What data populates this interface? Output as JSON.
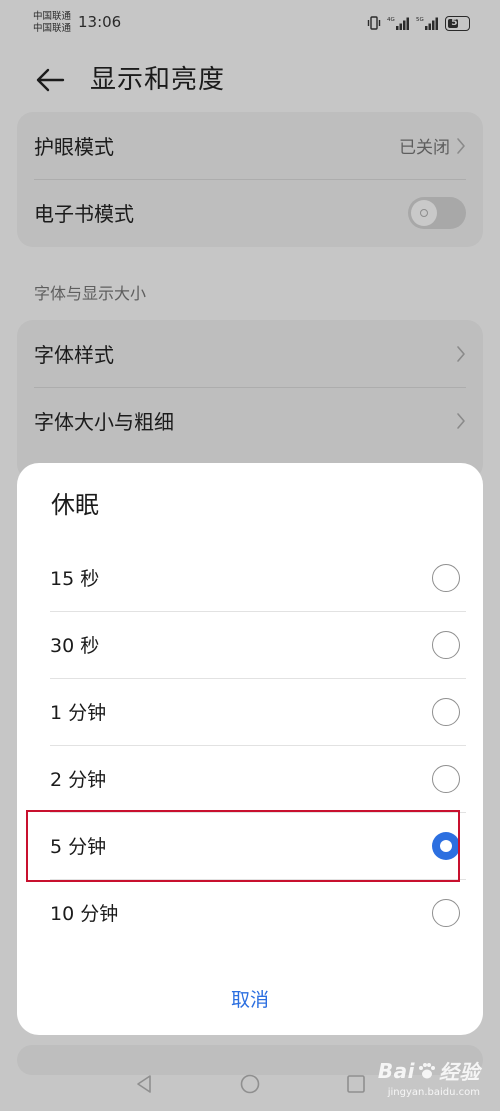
{
  "status_bar": {
    "carrier_1": "中国联通",
    "carrier_2": "中国联通",
    "time": "13:06",
    "battery": "58",
    "battery_level": 0.58,
    "network_1": "4G",
    "network_2": "5G",
    "icons": [
      "vibrate-icon",
      "signal-icon",
      "signal-icon"
    ]
  },
  "header": {
    "title": "显示和亮度",
    "back_icon": "arrow-left-icon"
  },
  "settings": {
    "eye_comfort": {
      "label": "护眼模式",
      "value": "已关闭"
    },
    "ebook_mode": {
      "label": "电子书模式",
      "enabled": false
    },
    "font_section_title": "字体与显示大小",
    "font_style": {
      "label": "字体样式"
    },
    "font_size": {
      "label": "字体大小与粗细"
    }
  },
  "dialog": {
    "title": "休眠",
    "options": [
      {
        "label": "15 秒",
        "selected": false
      },
      {
        "label": "30 秒",
        "selected": false
      },
      {
        "label": "1 分钟",
        "selected": false
      },
      {
        "label": "2 分钟",
        "selected": false
      },
      {
        "label": "5 分钟",
        "selected": true
      },
      {
        "label": "10 分钟",
        "selected": false
      }
    ],
    "cancel_label": "取消"
  },
  "nav": {
    "back_icon": "triangle-back-icon",
    "home_icon": "circle-home-icon",
    "recent_icon": "square-recent-icon"
  },
  "watermark": {
    "logo_text_1": "Bai",
    "logo_text_2": "经验",
    "sub_text": "jingyan.baidu.com"
  },
  "colors": {
    "accent": "#2c6fe0",
    "highlight": "#c8102e",
    "dim_background": "#c6c6c6"
  }
}
